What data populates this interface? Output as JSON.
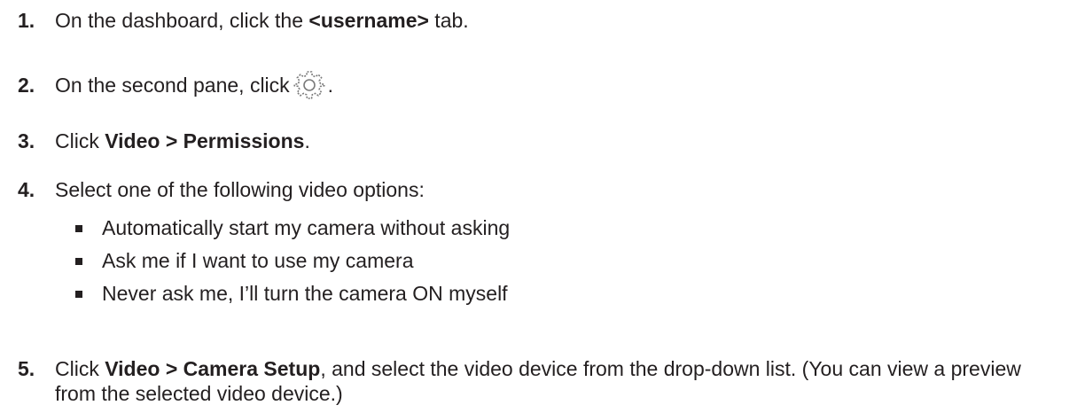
{
  "steps": [
    {
      "num": "1.",
      "pre": "On the dashboard, click the ",
      "bold": "<username>",
      "post": " tab."
    },
    {
      "num": "2.",
      "pre": "On the second pane, click ",
      "icon": "gear-icon",
      "post": "."
    },
    {
      "num": "3.",
      "pre": "Click ",
      "bold": "Video > Permissions",
      "post": "."
    },
    {
      "num": "4.",
      "pre": "Select one of the following video options:"
    },
    {
      "num": "5.",
      "pre": "Click ",
      "bold": "Video > Camera Setup",
      "post": ", and select the video device from the drop-down list. (You can view a preview from the selected video device.)"
    }
  ],
  "options": [
    "Automatically start my camera without asking",
    "Ask me if I want to use my camera",
    "Never ask me, I’ll turn the camera ON myself"
  ],
  "colors": {
    "text": "#231f20",
    "icon": "#7a7a7a"
  }
}
